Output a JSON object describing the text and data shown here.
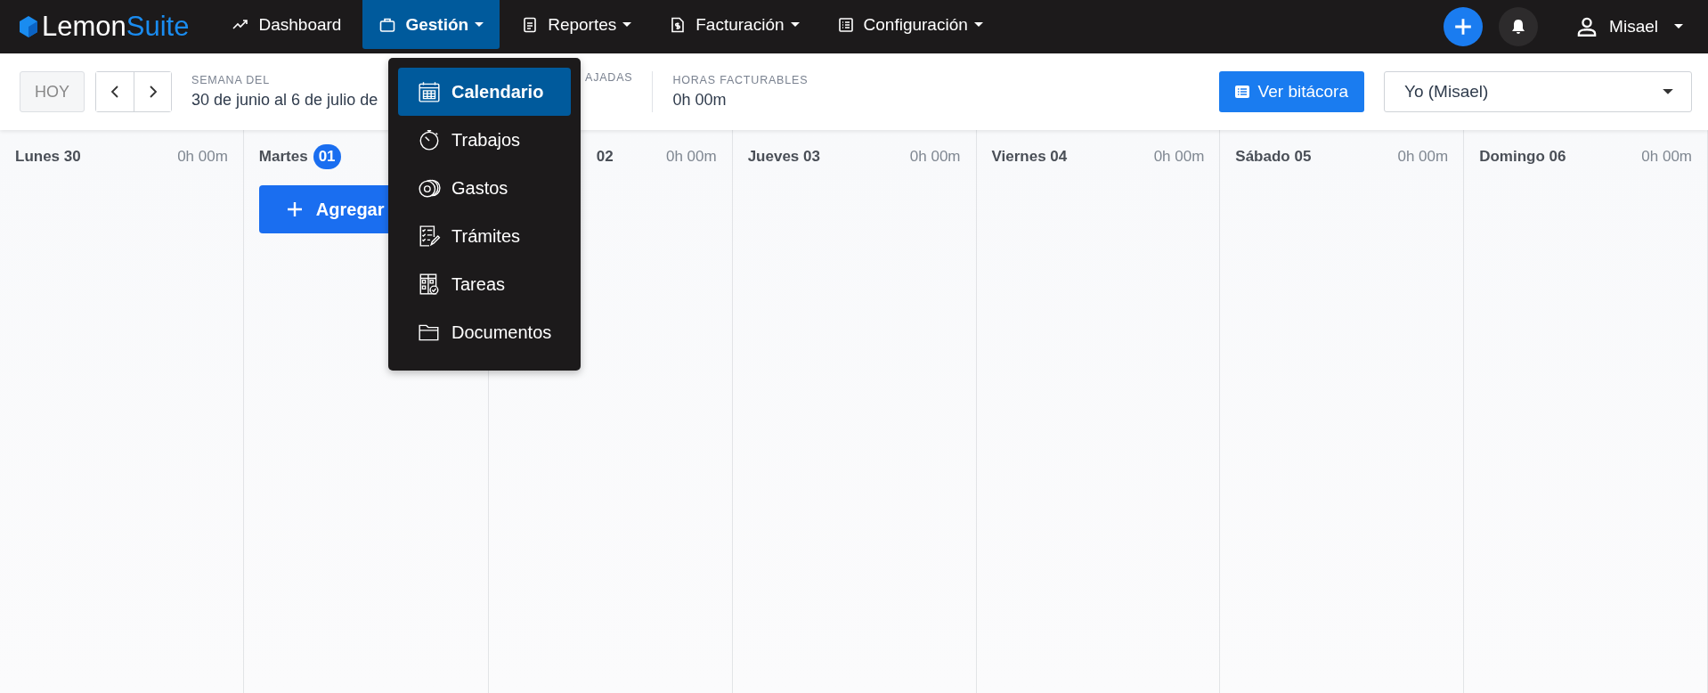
{
  "brand": {
    "part_1": "Lemon",
    "part_2": "Suite"
  },
  "nav": [
    {
      "label": "Dashboard",
      "kind": "trend",
      "dropdown": false,
      "selected": false
    },
    {
      "label": "Gestión",
      "kind": "briefcase",
      "dropdown": true,
      "selected": true
    },
    {
      "label": "Reportes",
      "kind": "document",
      "dropdown": true,
      "selected": false
    },
    {
      "label": "Facturación",
      "kind": "invoice",
      "dropdown": true,
      "selected": false
    },
    {
      "label": "Configuración",
      "kind": "list",
      "dropdown": true,
      "selected": false
    }
  ],
  "user": {
    "name": "Misael"
  },
  "toolbar": {
    "today": "HOY",
    "week_label": "SEMANA DEL",
    "week_range": "30 de junio al 6 de julio de",
    "stats": [
      {
        "label": "AJADAS"
      },
      {
        "label": "HORAS FACTURABLES",
        "value": "0h 00m"
      }
    ],
    "log_button": "Ver bitácora",
    "user_select": "Yo (Misael)"
  },
  "days": [
    {
      "name": "Lunes 30",
      "hours": "0h 00m"
    },
    {
      "name": "Martes",
      "badge": "01",
      "add_button": "Agregar"
    },
    {
      "name": "02",
      "hours": "0h 00m"
    },
    {
      "name": "Jueves 03",
      "hours": "0h 00m"
    },
    {
      "name": "Viernes 04",
      "hours": "0h 00m"
    },
    {
      "name": "Sábado 05",
      "hours": "0h 00m"
    },
    {
      "name": "Domingo 06",
      "hours": "0h 00m"
    }
  ],
  "menu": [
    {
      "label": "Calendario",
      "kind": "calendar",
      "selected": true
    },
    {
      "label": "Trabajos",
      "kind": "stopwatch",
      "selected": false
    },
    {
      "label": "Gastos",
      "kind": "coins",
      "selected": false
    },
    {
      "label": "Trámites",
      "kind": "checklist",
      "selected": false
    },
    {
      "label": "Tareas",
      "kind": "board",
      "selected": false
    },
    {
      "label": "Documentos",
      "kind": "folder",
      "selected": false
    }
  ]
}
